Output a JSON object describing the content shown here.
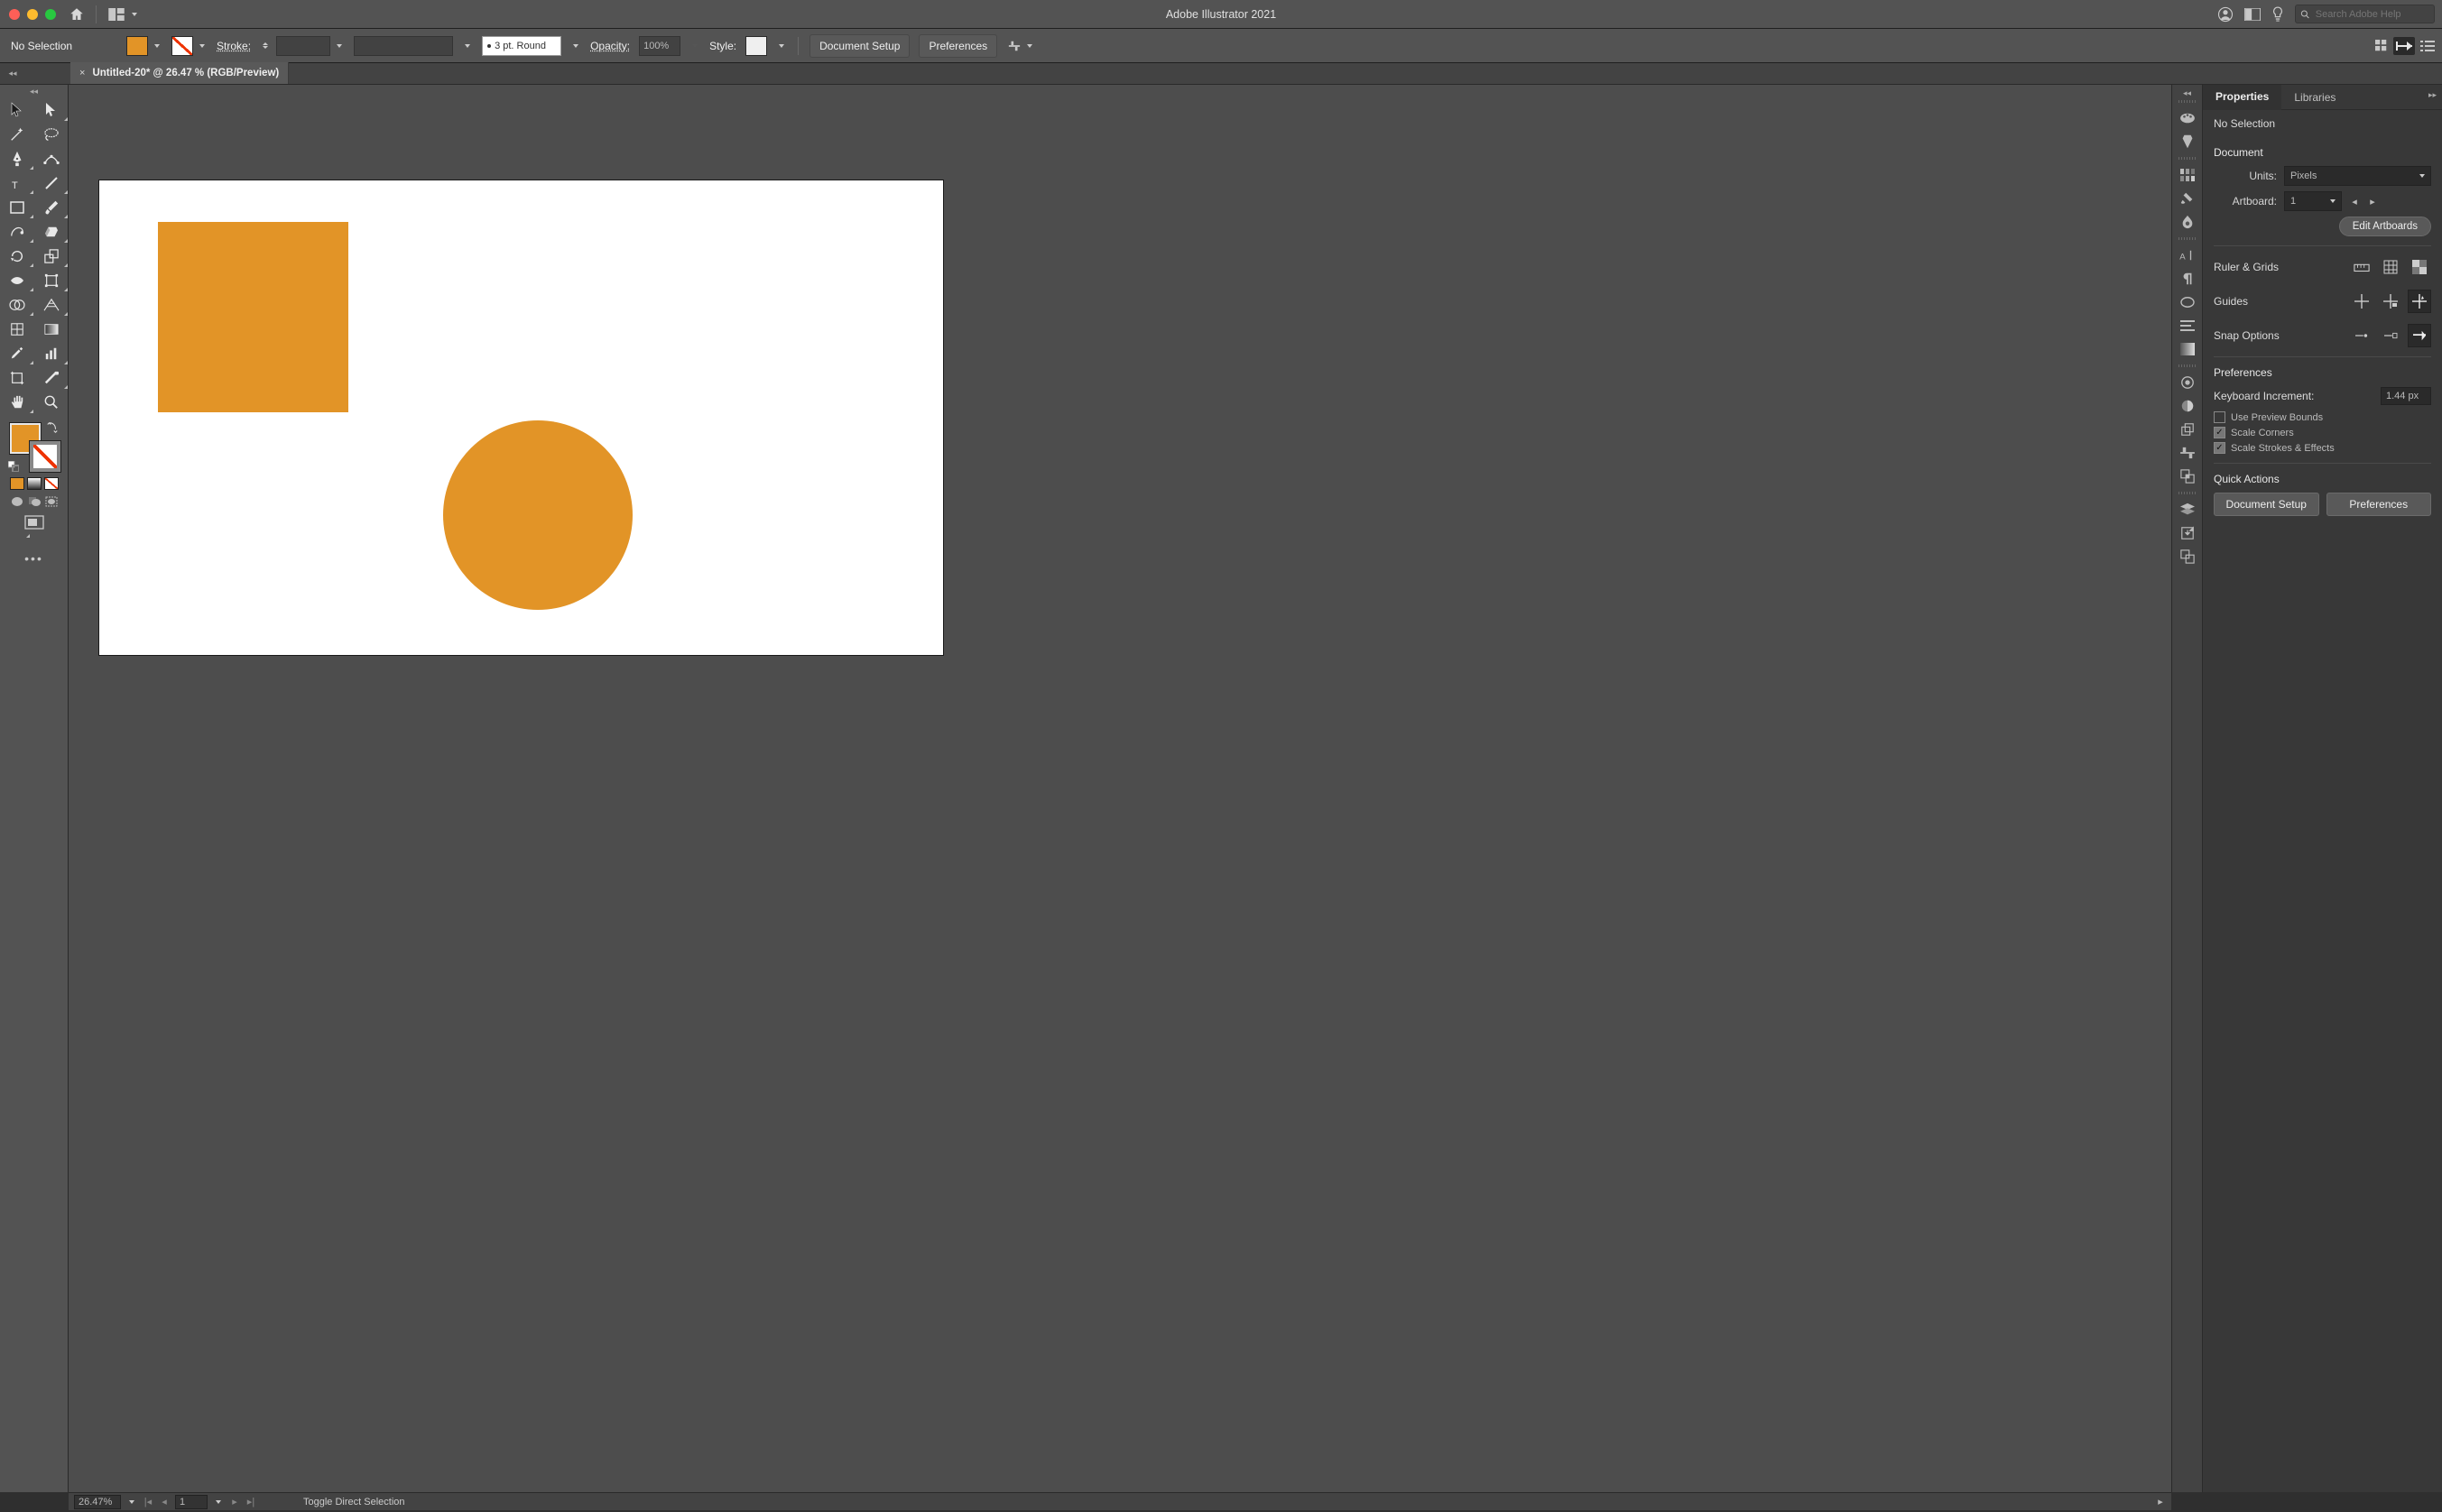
{
  "app": {
    "title": "Adobe Illustrator 2021",
    "search_placeholder": "Search Adobe Help"
  },
  "control": {
    "selection": "No Selection",
    "stroke_label": "Stroke:",
    "brush_label": "3 pt. Round",
    "opacity_label": "Opacity:",
    "opacity_value": "100%",
    "style_label": "Style:",
    "doc_setup": "Document Setup",
    "preferences": "Preferences",
    "fill_color": "#e29427"
  },
  "doc_tab": {
    "label": "Untitled-20* @ 26.47 % (RGB/Preview)"
  },
  "status": {
    "zoom": "26.47%",
    "artboard": "1",
    "hint": "Toggle Direct Selection"
  },
  "props": {
    "tabs": [
      "Properties",
      "Libraries"
    ],
    "selection": "No Selection",
    "doc_hdr": "Document",
    "units_label": "Units:",
    "units_value": "Pixels",
    "artboard_label": "Artboard:",
    "artboard_value": "1",
    "edit_artboards": "Edit Artboards",
    "ruler_hdr": "Ruler & Grids",
    "guides_hdr": "Guides",
    "snap_hdr": "Snap Options",
    "prefs_hdr": "Preferences",
    "kbd_label": "Keyboard Increment:",
    "kbd_value": "1.44 px",
    "chk_preview": "Use Preview Bounds",
    "chk_corners": "Scale Corners",
    "chk_strokes": "Scale Strokes & Effects",
    "quick_hdr": "Quick Actions",
    "qa1": "Document Setup",
    "qa2": "Preferences"
  }
}
